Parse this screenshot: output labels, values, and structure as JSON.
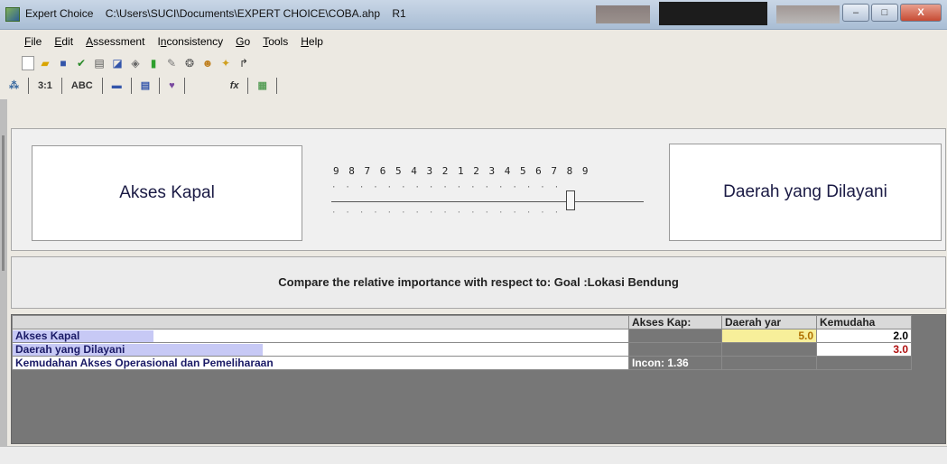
{
  "window": {
    "title": "Expert Choice    C:\\Users\\SUCI\\Documents\\EXPERT CHOICE\\COBA.ahp    R1",
    "buttons": {
      "minimize": "–",
      "maximize": "□",
      "close": "X"
    }
  },
  "menu": [
    {
      "label": "File"
    },
    {
      "label": "Edit"
    },
    {
      "label": "Assessment"
    },
    {
      "label": "Inconsistency"
    },
    {
      "label": "Go"
    },
    {
      "label": "Tools"
    },
    {
      "label": "Help"
    }
  ],
  "toolbar_icons": [
    "new-file-icon",
    "open-folder-icon",
    "save-icon",
    "check-icon",
    "print-icon",
    "print-preview-icon",
    "model-icon",
    "green-book-icon",
    "edit-icon",
    "sensitivity-icon",
    "people-icon",
    "wizard-icon",
    "arrow-icon"
  ],
  "tabs": [
    {
      "label": "⁂"
    },
    {
      "label": "3:1"
    },
    {
      "label": "ABC"
    },
    {
      "label": "▬"
    },
    {
      "label": "▤"
    },
    {
      "label": "♥"
    },
    {
      "label": "fx"
    },
    {
      "label": "▦"
    }
  ],
  "comparison": {
    "left_item": "Akses Kapal",
    "right_item": "Daerah yang Dilayani",
    "scale_numbers": "9 8 7 6 5 4 3 2 1 2 3 4 5 6 7 8 9",
    "slider_value_fraction": 0.78
  },
  "statement": "Compare the relative importance with respect to: Goal :Lokasi Bendung",
  "matrix": {
    "headers": [
      "Akses Kap:",
      "Daerah yar",
      "Kemudaha"
    ],
    "rows": [
      {
        "label": "Akses Kapal",
        "cells": [
          "",
          "5.0",
          "2.0"
        ],
        "bar_fraction": 0.23
      },
      {
        "label": "Daerah yang Dilayani",
        "cells": [
          "",
          "",
          "3.0"
        ],
        "bar_fraction": 0.41
      },
      {
        "label": "Kemudahan Akses Operasional dan Pemeliharaan",
        "cells": [
          "Incon: 1.36",
          "",
          ""
        ],
        "bar_fraction": 0.0
      }
    ]
  }
}
